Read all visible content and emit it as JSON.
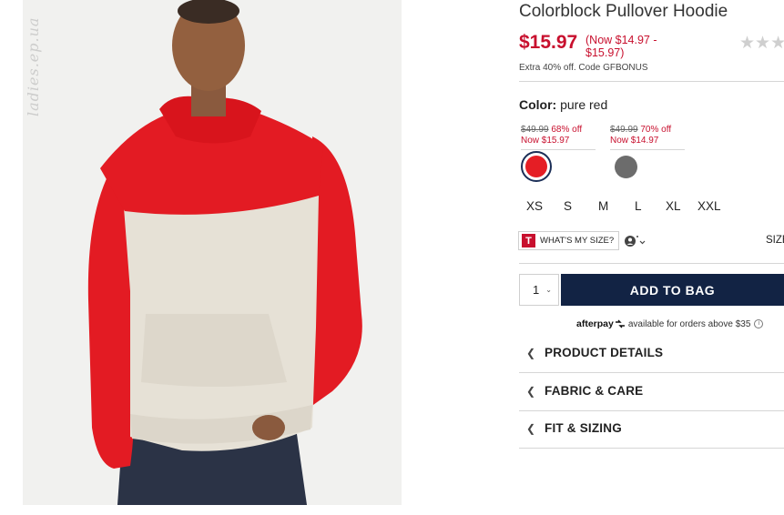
{
  "watermark": "ladies.ep.ua",
  "product": {
    "title": "Colorblock Pullover Hoodie",
    "price": "$15.97",
    "now_range": "(Now $14.97 - $15.97)",
    "rating_stars": "★★★",
    "promo": "Extra 40% off. Code GFBONUS"
  },
  "color": {
    "label": "Color:",
    "value": "pure red",
    "swatches": [
      {
        "was": "$49.99",
        "off": "68% off",
        "now": "Now $15.97",
        "color": "#e51e25",
        "selected": true
      },
      {
        "was": "$49.99",
        "off": "70% off",
        "now": "Now $14.97",
        "color": "#6c6c6c",
        "selected": false
      }
    ]
  },
  "sizes": [
    "XS",
    "S",
    "M",
    "L",
    "XL",
    "XXL"
  ],
  "fit_tools": {
    "whats_my_size_badge": "T",
    "whats_my_size": "WHAT'S MY SIZE?",
    "size_chart": "SIZE"
  },
  "purchase": {
    "quantity": "1",
    "add_to_bag": "ADD TO BAG"
  },
  "afterpay": {
    "logo": "afterpay",
    "text": "available for orders above $35",
    "info": "i"
  },
  "accordion": [
    {
      "label": "PRODUCT DETAILS"
    },
    {
      "label": "FABRIC & CARE"
    },
    {
      "label": "FIT & SIZING"
    }
  ],
  "colors": {
    "sale_red": "#c8102e",
    "navy": "#122344",
    "hoodie_red": "#e51e25",
    "hoodie_oatmeal": "#e6e1d6"
  }
}
